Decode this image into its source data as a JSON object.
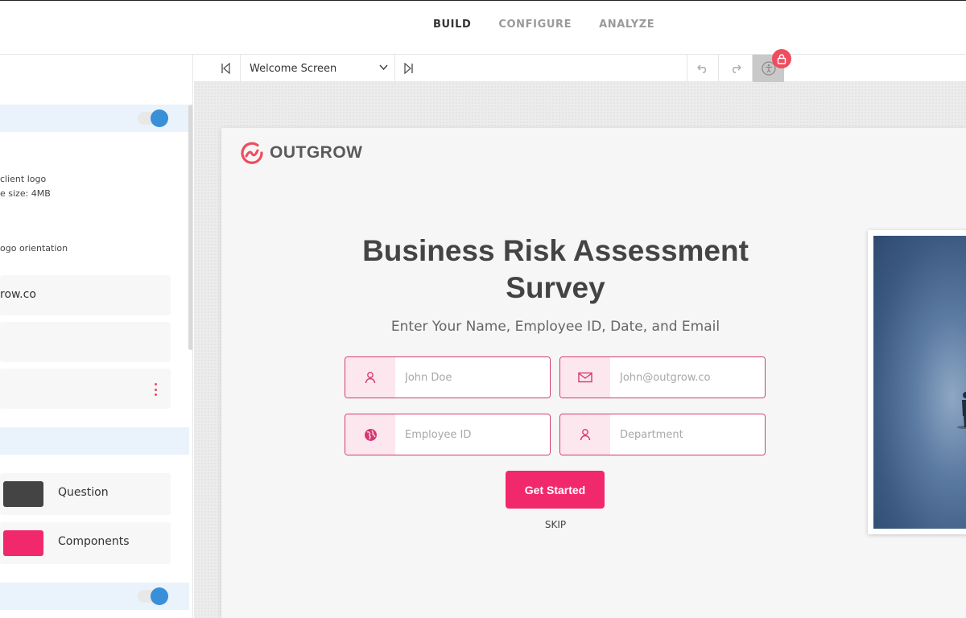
{
  "topnav": {
    "tabs": [
      "BUILD",
      "CONFIGURE",
      "ANALYZE"
    ],
    "active": "BUILD"
  },
  "sidebar": {
    "logo_help_1": "client logo",
    "logo_help_2": "e size: 4MB",
    "logo_orientation": "ogo orientation",
    "website": "row.co",
    "colors": [
      {
        "label": "Question",
        "color": "#444444"
      },
      {
        "label": "Components",
        "color": "#f2286d"
      }
    ],
    "toggle_on_color": "#3a8fd9"
  },
  "toolbar": {
    "screen_select": "Welcome Screen",
    "icons": [
      "first-screen-icon",
      "chevron-down-icon",
      "last-screen-icon",
      "undo-icon",
      "redo-icon",
      "accessibility-icon",
      "lock-icon"
    ]
  },
  "preview": {
    "brand": "OUTGROW",
    "title_line1": "Business Risk Assessment",
    "title_line2": "Survey",
    "subtitle": "Enter Your Name, Employee ID, Date, and Email",
    "fields": {
      "name_placeholder": "John Doe",
      "email_placeholder": "John@outgrow.co",
      "employee_placeholder": "Employee ID",
      "department_placeholder": "Department"
    },
    "cta_label": "Get Started",
    "skip_label": "SKIP",
    "accent_color": "#f2286d",
    "field_border_color": "#d33a72"
  }
}
